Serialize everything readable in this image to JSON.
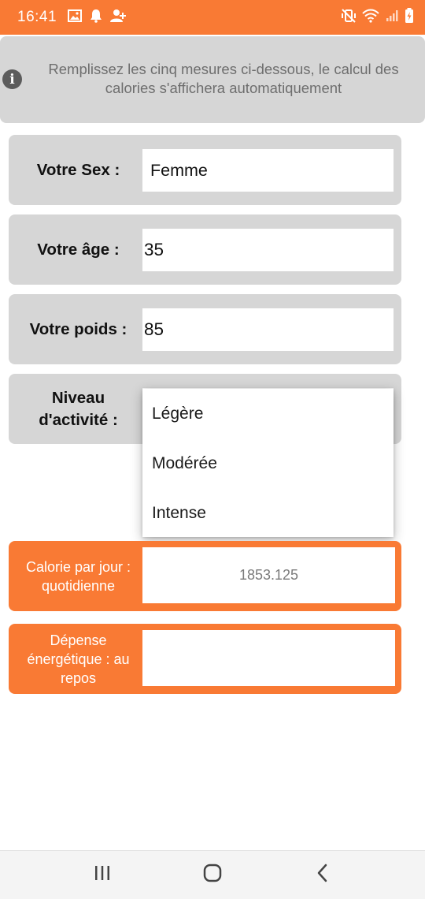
{
  "status_bar": {
    "time": "16:41",
    "left_icons": [
      "gallery-icon",
      "notification-bell-icon",
      "person-add-icon"
    ],
    "right_icons": [
      "mute-vibrate-icon",
      "wifi-icon",
      "signal-icon",
      "battery-charging-icon"
    ]
  },
  "info": {
    "text": "Remplissez les cinq mesures ci-dessous, le calcul des calories s'affichera automatiquement"
  },
  "form": {
    "sex_label": "Votre Sex :",
    "sex_value": "Femme",
    "age_label": "Votre âge :",
    "age_value": "35",
    "weight_label": "Votre poids :",
    "weight_value": "85",
    "activity_label": "Niveau d'activité :"
  },
  "activity_dropdown": {
    "options": [
      "Légère",
      "Modérée",
      "Intense"
    ]
  },
  "results": {
    "daily_calories_label": "Calorie par jour : quotidienne",
    "daily_calories_value": "1853.125",
    "resting_expenditure_label": "Dépense énergétique : au repos",
    "resting_expenditure_value": ""
  },
  "colors": {
    "accent": "#f97a34",
    "panel": "#d6d6d6"
  },
  "nav_bar": {
    "icons": [
      "recent-apps-icon",
      "home-icon",
      "back-icon"
    ]
  }
}
